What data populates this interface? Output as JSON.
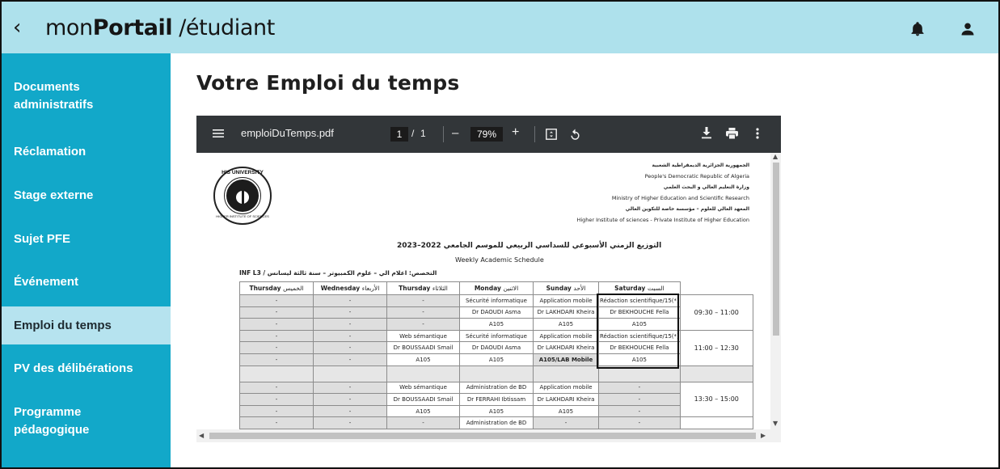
{
  "header": {
    "back_icon": "chevron-left-icon",
    "brand_prefix": "mon",
    "brand_bold": "Portail",
    "brand_suffix": "/étudiant",
    "bell_icon": "bell-icon",
    "user_icon": "user-icon"
  },
  "sidebar": {
    "items": [
      {
        "label": "Documents administratifs",
        "active": false
      },
      {
        "label": "Réclamation",
        "active": false
      },
      {
        "label": "Stage externe",
        "active": false
      },
      {
        "label": "Sujet PFE",
        "active": false
      },
      {
        "label": "Événement",
        "active": false
      },
      {
        "label": "Emploi du temps",
        "active": true
      },
      {
        "label": "PV des délibérations",
        "active": false
      },
      {
        "label": "Programme pédagogique",
        "active": false
      }
    ]
  },
  "main": {
    "title": "Votre Emploi du temps"
  },
  "viewer": {
    "filename": "emploiDuTemps.pdf",
    "current_page": "1",
    "page_separator": "/",
    "total_pages": "1",
    "zoom": "79%",
    "zoom_out": "–",
    "zoom_in": "+"
  },
  "document": {
    "header_lines": [
      {
        "ar": "الجمهورية الجزائرية الديمقراطية الشعبية",
        "en": "People's Democratic Republic of Algeria"
      },
      {
        "ar": "وزارة التعليم العالي و البحث العلمي",
        "en": "Ministry of Higher Education and Scientific Research"
      },
      {
        "ar": "المعهد العالي للعلوم – مؤسسة خاصة للتكوين العالي",
        "en": "Higher Institute of sciences - Private Institute of Higher Education"
      }
    ],
    "logo_top": "HIS UNIVERSITY",
    "logo_bottom": "HIGHER INSTITUTE OF SCIENCES",
    "title_ar": "التوزيع الزمني الأسبوعي للسداسي الربيعي للموسم الجامعي 2022–2023",
    "title_en": "Weekly Academic Schedule",
    "specialty_line": "INF L3  /  التخصص: اعلام الي – علوم الكمبيوتر – سنة ثالثة ليسانس",
    "columns": [
      {
        "en": "Thursday",
        "ar": "الخميس"
      },
      {
        "en": "Wednesday",
        "ar": "الأربعاء"
      },
      {
        "en": "Thursday",
        "ar": "الثلاثاء"
      },
      {
        "en": "Monday",
        "ar": "الاثنين"
      },
      {
        "en": "Sunday",
        "ar": "الأحد"
      },
      {
        "en": "Saturday",
        "ar": "السبت"
      }
    ],
    "slots": [
      {
        "time": "09:30 – 11:00",
        "rows": [
          [
            "-",
            "-",
            "-",
            "Sécurité informatique",
            "Application mobile",
            "Rédaction scientifique/15(*)"
          ],
          [
            "-",
            "-",
            "-",
            "Dr DAOUDI Asma",
            "Dr LAKHDARI Kheira",
            "Dr BEKHOUCHE Fella"
          ],
          [
            "-",
            "-",
            "-",
            "A105",
            "A105",
            "A105"
          ]
        ]
      },
      {
        "time": "11:00 – 12:30",
        "rows": [
          [
            "-",
            "-",
            "Web sémantique",
            "Sécurité informatique",
            "Application mobile",
            "Rédaction scientifique/15(*)"
          ],
          [
            "-",
            "-",
            "Dr BOUSSAADI Smail",
            "Dr DAOUDI Asma",
            "Dr LAKHDARI Kheira",
            "Dr BEKHOUCHE Fella"
          ],
          [
            "-",
            "-",
            "A105",
            "A105",
            "A105/LAB Mobile",
            "A105"
          ]
        ]
      },
      {
        "time": "13:30 – 15:00",
        "rows": [
          [
            "-",
            "-",
            "Web sémantique",
            "Administration de BD",
            "Application mobile",
            "-"
          ],
          [
            "-",
            "-",
            "Dr BOUSSAADI Smail",
            "Dr FERRAHI Ibtissam",
            "Dr LAKHDARI Kheira",
            "-"
          ],
          [
            "-",
            "-",
            "A105",
            "A105",
            "A105",
            "-"
          ],
          [
            "-",
            "-",
            "-",
            "Administration de BD",
            "-",
            "-"
          ]
        ]
      }
    ]
  },
  "colors": {
    "header_bg": "#aee1ec",
    "sidebar_bg": "#12a8c9",
    "sidebar_active_bg": "#b6e3ef",
    "toolbar_bg": "#323639"
  }
}
